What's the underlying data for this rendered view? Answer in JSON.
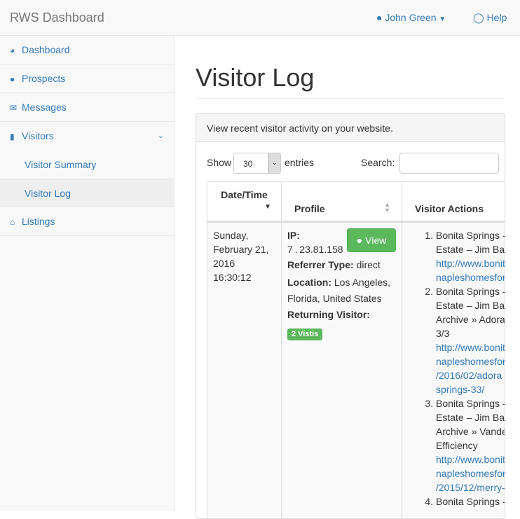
{
  "navbar": {
    "brand": "RWS Dashboard",
    "user": "John Green",
    "help": "Help"
  },
  "sidebar": {
    "items": [
      {
        "label": "Dashboard",
        "icon": "tachometer-icon"
      },
      {
        "label": "Prospects",
        "icon": "users-icon"
      },
      {
        "label": "Messages",
        "icon": "envelope-icon"
      },
      {
        "label": "Visitors",
        "icon": "bar-chart-icon"
      },
      {
        "label": "Visitor Summary"
      },
      {
        "label": "Visitor Log",
        "active": true
      },
      {
        "label": "Listings",
        "icon": "home-icon"
      }
    ]
  },
  "page": {
    "title": "Visitor Log"
  },
  "panel": {
    "heading": "View recent visitor activity on your website.",
    "show": "Show",
    "entries_value": "30",
    "entries": "entries",
    "search": "Search:",
    "search_value": ""
  },
  "table": {
    "columns": [
      "Date/Time",
      "Profile",
      "Visitor Actions"
    ],
    "row": {
      "date": [
        "Sunday,",
        "February 21,",
        "2016",
        "16:30:12"
      ],
      "ip_label": "IP:",
      "ip": "7 . 23.81.158",
      "view": "View",
      "ref_label": "Referrer Type:",
      "ref": "direct",
      "loc_label": "Location:",
      "loc1": "Los Angeles,",
      "loc2": "Florida, United States",
      "ret_label": "Returning Visitor:",
      "visits": "2 Vistis",
      "actions": [
        {
          "lines": [
            "Bonita Springs -",
            "Estate – Jim Ba"
          ],
          "links": [
            "http://www.bonit",
            "napleshomesfor"
          ]
        },
        {
          "lines": [
            "Bonita Springs -",
            "Estate – Jim Ba",
            "Archive » Adora",
            "3/3"
          ],
          "links": [
            "http://www.bonit",
            "napleshomesfor",
            "/2016/02/adora",
            "springs-33/"
          ]
        },
        {
          "lines": [
            "Bonita Springs -",
            "Estate – Jim Ba",
            "Archive » Vande",
            "Efficiency"
          ],
          "links": [
            "http://www.bonit",
            "napleshomesfor",
            "/2015/12/merry-"
          ]
        },
        {
          "lines": [
            "Bonita Springs -"
          ],
          "links": []
        }
      ]
    }
  },
  "colors": {
    "link": "#337ab7",
    "success": "#5cb85c"
  }
}
